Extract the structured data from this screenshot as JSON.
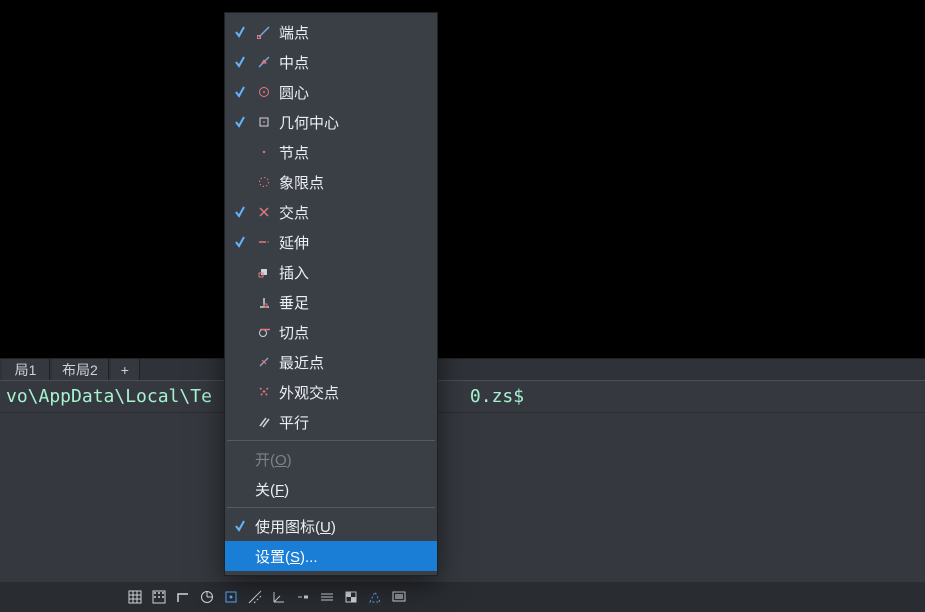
{
  "tabs": {
    "items": [
      {
        "label": "局1"
      },
      {
        "label": "布局2"
      }
    ],
    "add_label": "+"
  },
  "cmdline": {
    "left": "vo\\AppData\\Local\\Te",
    "right": "0.zs$"
  },
  "menu": {
    "items": [
      {
        "label": "端点",
        "checked": true,
        "icon": "endpoint"
      },
      {
        "label": "中点",
        "checked": true,
        "icon": "midpoint"
      },
      {
        "label": "圆心",
        "checked": true,
        "icon": "center"
      },
      {
        "label": "几何中心",
        "checked": true,
        "icon": "geocenter"
      },
      {
        "label": "节点",
        "checked": false,
        "icon": "node"
      },
      {
        "label": "象限点",
        "checked": false,
        "icon": "quadrant"
      },
      {
        "label": "交点",
        "checked": true,
        "icon": "intersection"
      },
      {
        "label": "延伸",
        "checked": true,
        "icon": "extension"
      },
      {
        "label": "插入",
        "checked": false,
        "icon": "insert"
      },
      {
        "label": "垂足",
        "checked": false,
        "icon": "perpendicular"
      },
      {
        "label": "切点",
        "checked": false,
        "icon": "tangent"
      },
      {
        "label": "最近点",
        "checked": false,
        "icon": "nearest"
      },
      {
        "label": "外观交点",
        "checked": false,
        "icon": "apparent"
      },
      {
        "label": "平行",
        "checked": false,
        "icon": "parallel"
      }
    ],
    "open_pre": "开(",
    "open_hot": "O",
    "open_post": ")",
    "close_pre": "关(",
    "close_hot": "F",
    "close_post": ")",
    "useicon_pre": "使用图标(",
    "useicon_hot": "U",
    "useicon_post": ")",
    "useicon_checked": true,
    "settings_pre": "设置(",
    "settings_hot": "S",
    "settings_post": ")..."
  },
  "statusbar": {
    "items": [
      {
        "name": "grid-icon"
      },
      {
        "name": "snap-grid-icon"
      },
      {
        "name": "ortho-icon"
      },
      {
        "name": "polar-icon"
      },
      {
        "name": "osnap-icon"
      },
      {
        "name": "otrack-icon"
      },
      {
        "name": "dynucs-icon"
      },
      {
        "name": "lineweight-icon"
      },
      {
        "name": "annotations-icon"
      },
      {
        "name": "transparency-icon"
      },
      {
        "name": "selection-icon"
      },
      {
        "name": "model-icon"
      }
    ]
  }
}
